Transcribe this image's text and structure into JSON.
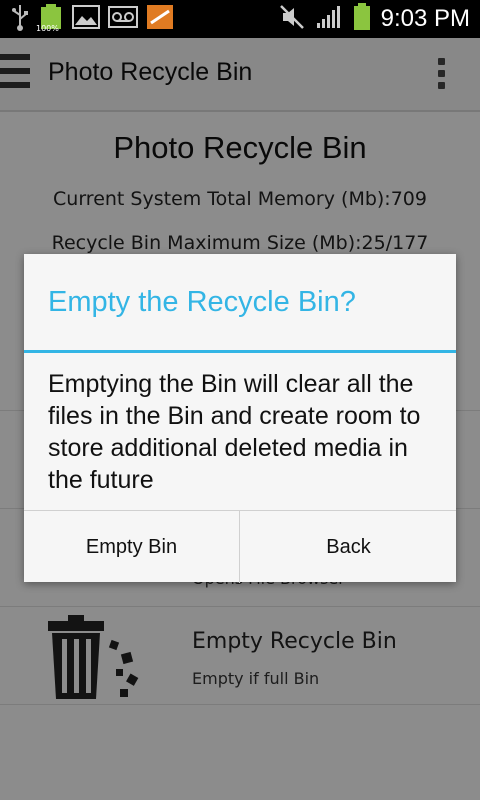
{
  "statusbar": {
    "time": "9:03 PM",
    "battery_small_label": "100%",
    "icons": [
      "usb-icon",
      "battery-full-icon",
      "picture-icon",
      "voicemail-icon",
      "app-zone-icon",
      "mute-icon",
      "signal-icon",
      "battery-icon"
    ],
    "colors": {
      "battery": "#8bc53f",
      "zone": "#e07b22"
    }
  },
  "actionbar": {
    "title": "Photo Recycle Bin",
    "menu_icon": "hamburger-icon",
    "overflow_icon": "overflow-menu-icon"
  },
  "main": {
    "title": "Photo Recycle Bin",
    "memory_line": "Current System Total Memory (Mb):709",
    "max_size_line": "Recycle Bin Maximum Size (Mb):25/177",
    "rows": [
      {
        "title": "",
        "subtitle": "Opens File Browser",
        "icon": "folder-icon"
      },
      {
        "title": "Empty Recycle Bin",
        "subtitle": "Empty if full Bin",
        "icon": "trash-can-icon"
      }
    ]
  },
  "dialog": {
    "title": "Empty the Recycle Bin?",
    "message": "Emptying the Bin will clear all the files in the Bin and create room to store additional deleted media in the future",
    "buttons": {
      "confirm": "Empty Bin",
      "cancel": "Back"
    },
    "accent_color": "#33b5e5"
  }
}
